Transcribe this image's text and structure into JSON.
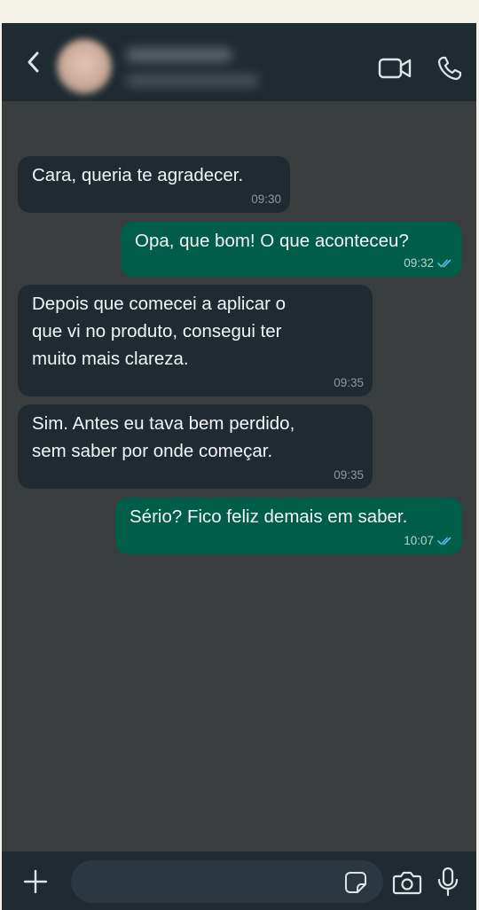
{
  "header": {
    "back_icon": "chevron-left-icon",
    "video_icon": "video-camera-icon",
    "phone_icon": "phone-icon"
  },
  "messages": [
    {
      "direction": "in",
      "text": "Cara, queria te agradecer.",
      "time": "09:30"
    },
    {
      "direction": "out",
      "text": "Opa, que bom! O que aconteceu?",
      "time": "09:32",
      "status": "read"
    },
    {
      "direction": "in",
      "text": "Depois que comecei a aplicar o\nque vi no produto, consegui ter\nmuito mais clareza.",
      "time": "09:35"
    },
    {
      "direction": "in",
      "text": "Sim. Antes eu tava bem perdido,\nsem saber por onde começar.",
      "time": "09:35"
    },
    {
      "direction": "out",
      "text": "Sério? Fico feliz demais em saber.",
      "time": "10:07",
      "status": "read"
    }
  ],
  "input_bar": {
    "placeholder": "",
    "plus_icon": "plus-icon",
    "sticker_icon": "sticker-icon",
    "camera_icon": "camera-icon",
    "mic_icon": "microphone-icon"
  },
  "colors": {
    "header_bg": "#1f2b31",
    "chat_bg": "#3a3d3d",
    "incoming_bubble": "#1f2b31",
    "outgoing_bubble": "#005d47",
    "read_tick": "#53bdeb"
  }
}
